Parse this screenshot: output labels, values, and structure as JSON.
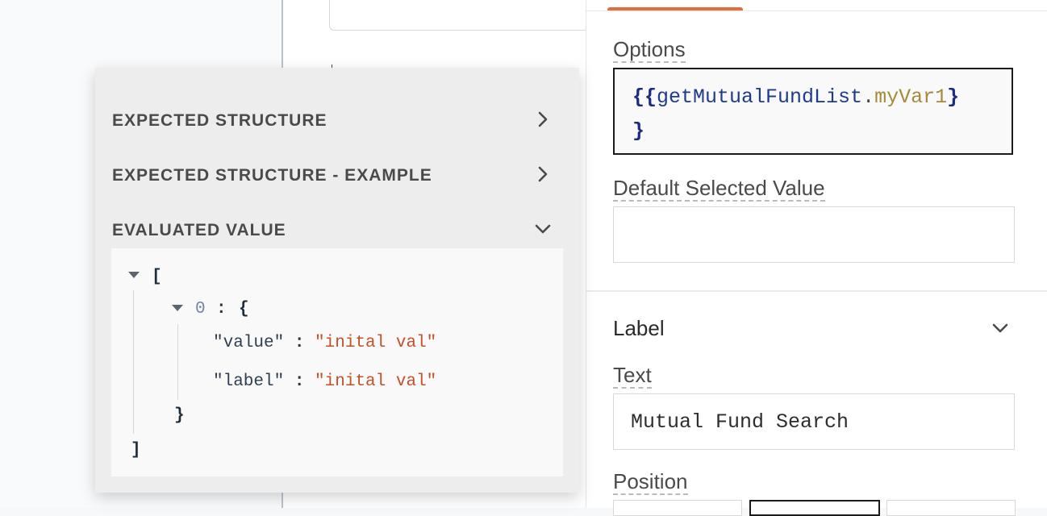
{
  "property_pane": {
    "options": {
      "label": "Options",
      "code_open": "{{",
      "code_object": "getMutualFundList",
      "code_dot": ".",
      "code_property": "myVar1",
      "code_close_a": "}",
      "code_close_b": "}"
    },
    "default_selected_value": {
      "label": "Default Selected Value",
      "value": ""
    },
    "label_section": {
      "heading": "Label",
      "text_label": "Text",
      "text_value": "Mutual Fund Search",
      "position_label": "Position"
    }
  },
  "popover": {
    "sections": [
      {
        "title": "EXPECTED STRUCTURE",
        "expanded": false
      },
      {
        "title": "EXPECTED STRUCTURE - EXAMPLE",
        "expanded": false
      },
      {
        "title": "EVALUATED VALUE",
        "expanded": true
      }
    ],
    "evaluated": {
      "root_open": "[",
      "item_index": "0",
      "item_colon": ":",
      "item_open": "{",
      "rows": [
        {
          "key": "\"value\"",
          "sep": ":",
          "val": "\"inital val\""
        },
        {
          "key": "\"label\"",
          "sep": ":",
          "val": "\"inital val\""
        }
      ],
      "item_close": "}",
      "root_close": "]"
    }
  },
  "colors": {
    "accent_tab": "#e36d3a",
    "string_value": "#c0512a",
    "brace": "#1c2a82"
  }
}
